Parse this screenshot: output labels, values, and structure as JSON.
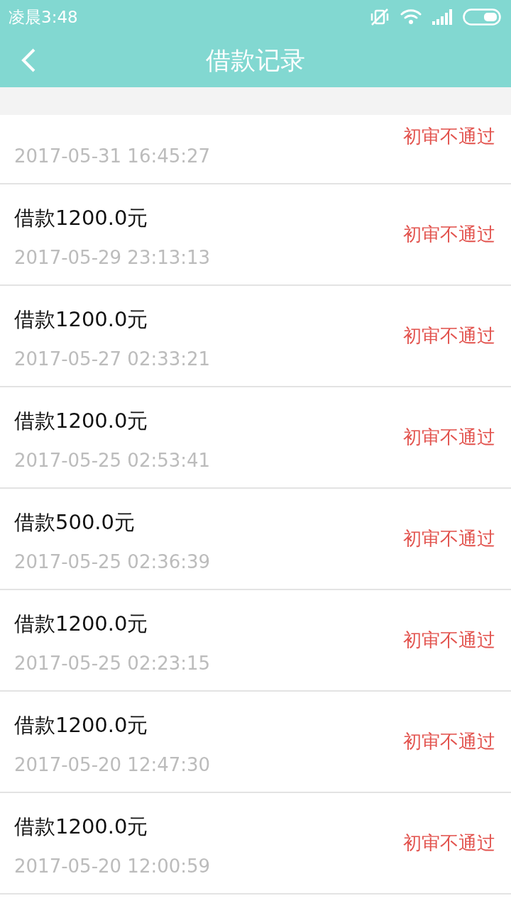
{
  "status_bar": {
    "time": "凌晨3:48"
  },
  "nav": {
    "title": "借款记录"
  },
  "records": [
    {
      "kind": "partial",
      "date": "2017-05-31 16:45:27",
      "status": "初审不通过"
    },
    {
      "kind": "full",
      "title": "借款1200.0元",
      "date": "2017-05-29 23:13:13",
      "status": "初审不通过"
    },
    {
      "kind": "full",
      "title": "借款1200.0元",
      "date": "2017-05-27 02:33:21",
      "status": "初审不通过"
    },
    {
      "kind": "full",
      "title": "借款1200.0元",
      "date": "2017-05-25 02:53:41",
      "status": "初审不通过"
    },
    {
      "kind": "full",
      "title": "借款500.0元",
      "date": "2017-05-25 02:36:39",
      "status": "初审不通过"
    },
    {
      "kind": "full",
      "title": "借款1200.0元",
      "date": "2017-05-25 02:23:15",
      "status": "初审不通过"
    },
    {
      "kind": "full",
      "title": "借款1200.0元",
      "date": "2017-05-20 12:47:30",
      "status": "初审不通过"
    },
    {
      "kind": "full",
      "title": "借款1200.0元",
      "date": "2017-05-20 12:00:59",
      "status": "初审不通过"
    }
  ]
}
